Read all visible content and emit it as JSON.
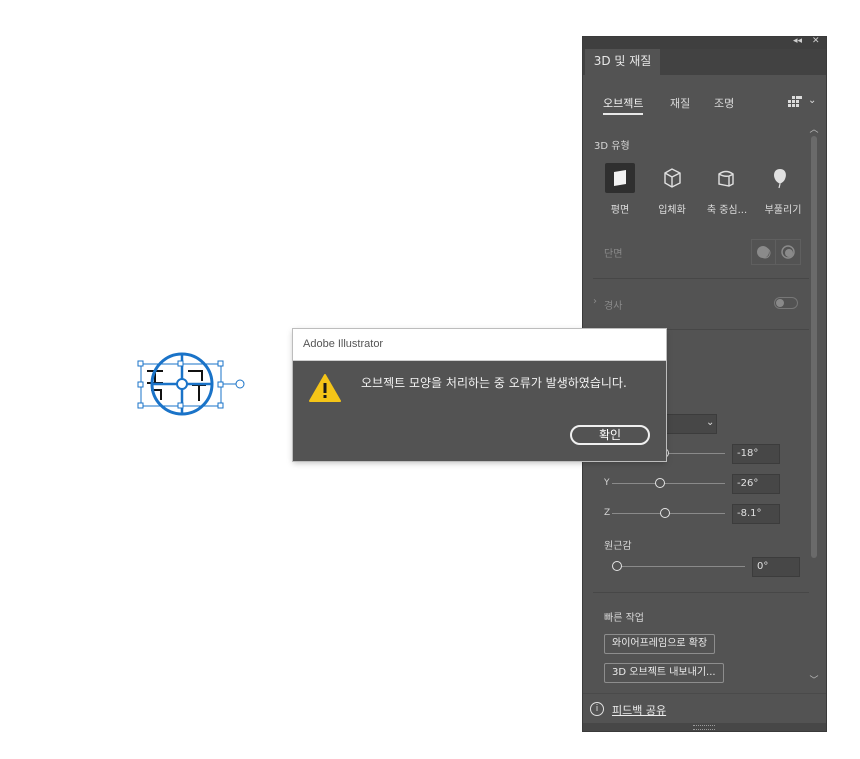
{
  "dialog": {
    "title": "Adobe Illustrator",
    "message": "오브젝트 모양을 처리하는 중 오류가 발생하였습니다.",
    "ok_label": "확인",
    "icon": "warning-icon"
  },
  "panel": {
    "title": "3D 및 재질",
    "tabs": [
      "오브젝트",
      "재질",
      "조명"
    ],
    "active_tab": "오브젝트",
    "type_section_label": "3D 유형",
    "types": [
      "평면",
      "입체화",
      "축 중심...",
      "부풀리기"
    ],
    "selected_type": "평면",
    "cap_label": "단면",
    "bevel_label": "경사",
    "bevel_enabled": false,
    "rotation": {
      "x_value": "-18°",
      "y_label": "Y",
      "y_value": "-26°",
      "z_label": "Z",
      "z_value": "-8.1°",
      "x_level": 0.45,
      "y_level": 0.4,
      "z_level": 0.47
    },
    "perspective_label": "원근감",
    "perspective_value": "0°",
    "quick_actions_label": "빠른 작업",
    "quick_actions": [
      "와이어프레임으로 확장",
      "3D 오브젝트 내보내기..."
    ],
    "feedback_label": "피드백 공유"
  },
  "colors": {
    "panel_bg": "#535353",
    "selection_blue": "#1a73c8",
    "warning": "#f5c518"
  }
}
